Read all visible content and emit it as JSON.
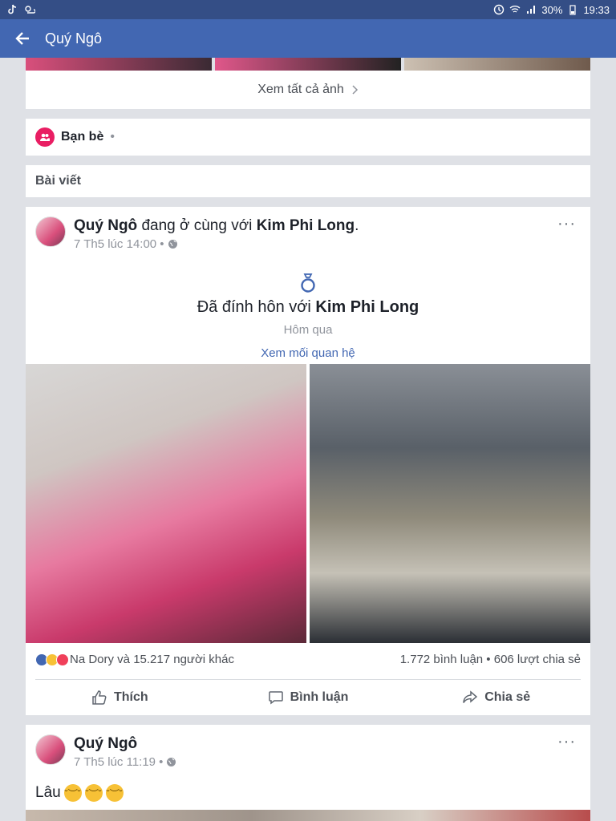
{
  "status_bar": {
    "battery": "30%",
    "time": "19:33"
  },
  "header": {
    "title": "Quý Ngô"
  },
  "photos": {
    "see_all": "Xem tất cả ảnh"
  },
  "friends": {
    "label": "Bạn bè",
    "dot": "•"
  },
  "posts": {
    "label": "Bài viết"
  },
  "post1": {
    "author": "Quý Ngô",
    "with_text": "đang ở cùng với",
    "tagged": "Kim Phi Long",
    "period": ".",
    "timestamp": "7 Th5 lúc 14:00 •",
    "life_event": {
      "title_prefix": "Đã đính hôn với",
      "title_name": "Kim Phi Long",
      "subtitle": "Hôm qua",
      "link": "Xem mối quan hệ"
    },
    "reactions_text": "Na Dory và 15.217 người khác",
    "comments_shares": "1.772 bình luận • 606 lượt chia sẻ",
    "actions": {
      "like": "Thích",
      "comment": "Bình luận",
      "share": "Chia sẻ"
    }
  },
  "post2": {
    "author": "Quý Ngô",
    "timestamp": "7 Th5 lúc 11:19 •",
    "text": "Lâu"
  },
  "icons": [
    "back-arrow-icon",
    "friends-icon",
    "globe-icon",
    "ring-icon",
    "more-icon",
    "like-icon",
    "comment-icon",
    "share-icon"
  ]
}
